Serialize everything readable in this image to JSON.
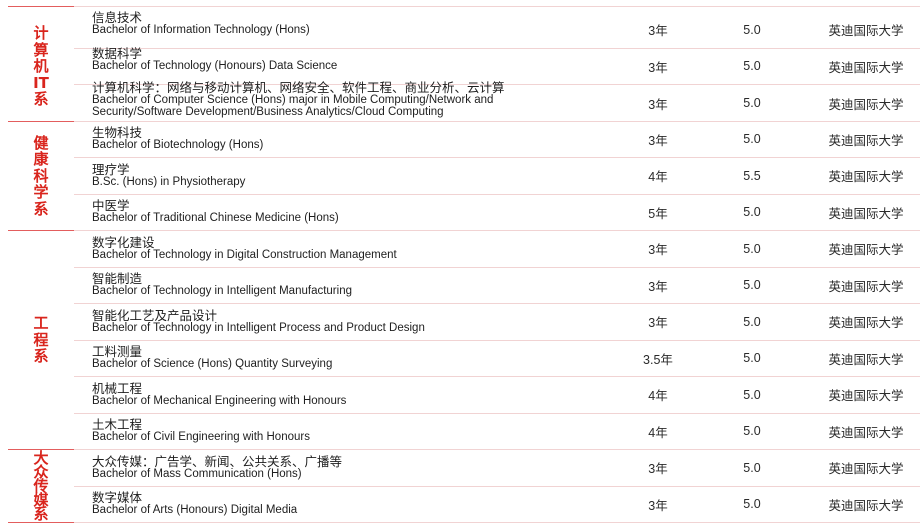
{
  "colors": {
    "accent": "#d9251d",
    "group_divider": "#e35d5d",
    "row_divider": "#f1d3d3",
    "text": "#1e1e1e"
  },
  "groups": [
    {
      "label": "计算机IT系",
      "rows": [
        {
          "cn": "信息技术",
          "en": "Bachelor of Information Technology (Hons)",
          "duration": "3年",
          "ielts": "5.0",
          "university": "英迪国际大学"
        },
        {
          "cn": "数据科学",
          "en": "Bachelor of Technology (Honours) Data Science",
          "duration": "3年",
          "ielts": "5.0",
          "university": "英迪国际大学"
        },
        {
          "cn": "计算机科学：网络与移动计算机、网络安全、软件工程、商业分析、云计算",
          "en": "Bachelor of Computer Science (Hons) major in Mobile Computing/Network and Security/Software Development/Business Analytics/Cloud Computing",
          "duration": "3年",
          "ielts": "5.0",
          "university": "英迪国际大学"
        }
      ]
    },
    {
      "label": "健康科学系",
      "rows": [
        {
          "cn": "生物科技",
          "en": "Bachelor of Biotechnology (Hons)",
          "duration": "3年",
          "ielts": "5.0",
          "university": "英迪国际大学"
        },
        {
          "cn": "理疗学",
          "en": "B.Sc. (Hons) in Physiotherapy",
          "duration": "4年",
          "ielts": "5.5",
          "university": "英迪国际大学"
        },
        {
          "cn": "中医学",
          "en": "Bachelor of Traditional Chinese Medicine (Hons)",
          "duration": "5年",
          "ielts": "5.0",
          "university": "英迪国际大学"
        }
      ]
    },
    {
      "label": "工程系",
      "rows": [
        {
          "cn": "数字化建设",
          "en": "Bachelor of Technology in Digital Construction Management",
          "duration": "3年",
          "ielts": "5.0",
          "university": "英迪国际大学"
        },
        {
          "cn": "智能制造",
          "en": "Bachelor of Technology in Intelligent Manufacturing",
          "duration": "3年",
          "ielts": "5.0",
          "university": "英迪国际大学"
        },
        {
          "cn": "智能化工艺及产品设计",
          "en": "Bachelor of Technology in Intelligent Process and Product Design",
          "duration": "3年",
          "ielts": "5.0",
          "university": "英迪国际大学"
        },
        {
          "cn": "工料测量",
          "en": "Bachelor of Science (Hons) Quantity Surveying",
          "duration": "3.5年",
          "ielts": "5.0",
          "university": "英迪国际大学"
        },
        {
          "cn": "机械工程",
          "en": "Bachelor of Mechanical Engineering with Honours",
          "duration": "4年",
          "ielts": "5.0",
          "university": "英迪国际大学"
        },
        {
          "cn": "土木工程",
          "en": "Bachelor of Civil Engineering with Honours",
          "duration": "4年",
          "ielts": "5.0",
          "university": "英迪国际大学"
        }
      ]
    },
    {
      "label": "大众传媒系",
      "rows": [
        {
          "cn": "大众传媒：广告学、新闻、公共关系、广播等",
          "en": "Bachelor of Mass Communication (Hons)",
          "duration": "3年",
          "ielts": "5.0",
          "university": "英迪国际大学"
        },
        {
          "cn": "数字媒体",
          "en": "Bachelor of Arts (Honours) Digital Media",
          "duration": "3年",
          "ielts": "5.0",
          "university": "英迪国际大学"
        }
      ]
    }
  ]
}
